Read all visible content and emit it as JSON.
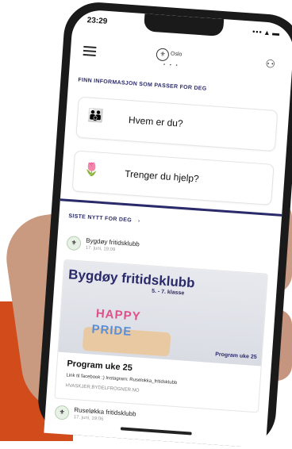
{
  "status": {
    "time": "23:29",
    "icons": "••• ▴ ▬"
  },
  "nav": {
    "logo": "Oslo",
    "page_dots": "• • •"
  },
  "find_info": {
    "title": "FINN INFORMASJON SOM PASSER FOR DEG"
  },
  "cards": [
    {
      "label": "Hvem er du?",
      "icon": "people-icon"
    },
    {
      "label": "Trenger du hjelp?",
      "icon": "flowers-icon"
    }
  ],
  "news": {
    "title": "SISTE NYTT FOR DEG",
    "chevron": "›",
    "items": [
      {
        "source": "Bygdøy fritidsklubb",
        "date": "17. juni, 19:09",
        "banner_title": "Bygdøy fritidsklubb",
        "banner_sub": "5. - 7. klasse",
        "banner_text1": "HAPPY",
        "banner_text2": "PRIDE",
        "banner_tag": "Program uke 25",
        "post_title": "Program uke 25",
        "post_desc": "Link til facebook :) Instagram: Ruselokka_fritidsklubb",
        "post_link": "HVASKJER.BYDELFROGNER.NO"
      },
      {
        "source": "Ruseløkka fritidsklubb",
        "date": "17. juni, 19:06"
      }
    ]
  },
  "colors": {
    "brand_navy": "#2a2a6a",
    "orange": "#d24b1b"
  }
}
